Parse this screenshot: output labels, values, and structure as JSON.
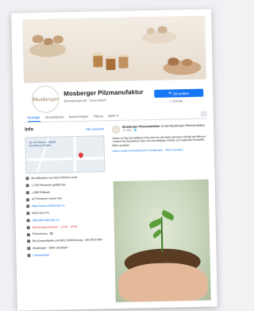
{
  "page": {
    "name": "Mosberger Pilzmanufaktur",
    "handle": "@mosbergerpilz · Gesundheit",
    "avatar_text": "Mosberger",
    "contact_button": "Schreiben",
    "follow_button": "Gefolgt"
  },
  "tabs": [
    "Beiträge",
    "Verweildauer",
    "Bewertungen",
    "Videos",
    "Mehr ▾"
  ],
  "info": {
    "title": "Info",
    "see_all": "Alle ansehen",
    "map_label": "am Kirchweg 3, 06618 Naumburg (Saale)",
    "rows": [
      {
        "icon": "info-icon",
        "text": "Bio-Edelpilze aus dem Rhöner Land",
        "style": ""
      },
      {
        "icon": "likes-icon",
        "text": "1.709 Personen gefällt das",
        "style": ""
      },
      {
        "icon": "followers-icon",
        "text": "1.808 Follower",
        "style": ""
      },
      {
        "icon": "checkin-icon",
        "text": "42 Personen waren hier",
        "style": ""
      },
      {
        "icon": "web-icon",
        "text": "https://www.mosberger.eu",
        "style": "link"
      },
      {
        "icon": "phone-icon",
        "text": "0934 241 571",
        "style": ""
      },
      {
        "icon": "mail-icon",
        "text": "office@mosberger.eu",
        "style": "link"
      },
      {
        "icon": "clock-icon",
        "text": "Derzeit geschlossen · 13:00 - 18:00",
        "style": "red"
      },
      {
        "icon": "price-icon",
        "text": "Preisniveau · $$",
        "style": ""
      },
      {
        "icon": "tag-icon",
        "text": "Bio-Kontrollstelle und BIO Zertifizierung · DE-ÖKO-006",
        "style": ""
      },
      {
        "icon": "info-icon-2",
        "text": "Mosberger · Mehr anzeigen",
        "style": ""
      },
      {
        "icon": "category-icon",
        "text": "Lebensmittel",
        "style": "link"
      }
    ]
  },
  "post": {
    "author": "Mosberger Pilzmanufaktur",
    "author_suffix": "ist bei Mosberger Pilzmanufaktur",
    "time": "12. März · 🌐",
    "text": "Heute ist Tag des Waldes! Pilze sind für die Natur genauso wichtig wie Bäume. Unsere Pilzmanufaktur setzt auf nachhaltigen Anbau und regionale Rohstoffe. Mehr ansehen",
    "tags": "#pilze #wald #nachhaltig #bio #mosberger · Mehr anzeigen"
  }
}
